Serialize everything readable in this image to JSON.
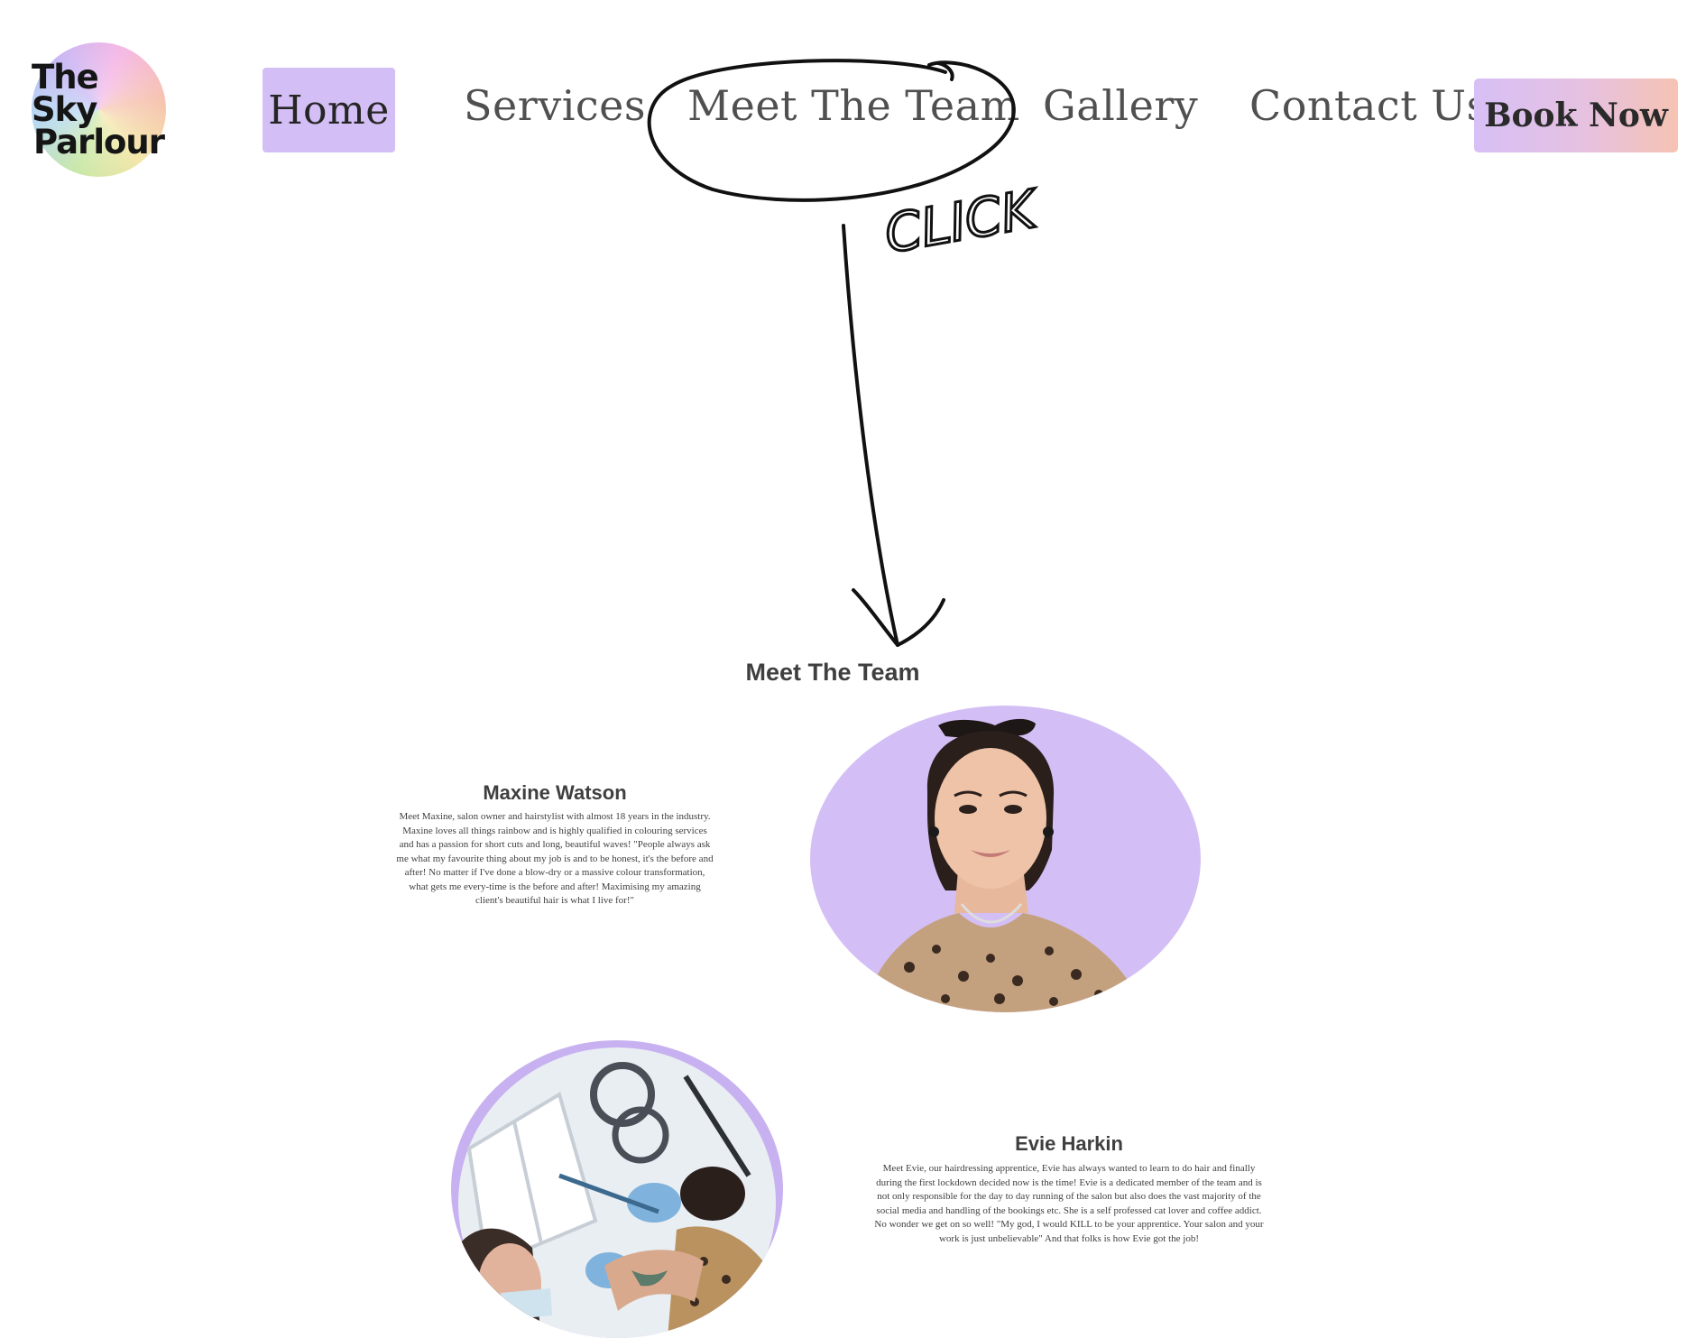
{
  "logo": {
    "line1": "The Sky",
    "line2": "Parlour"
  },
  "nav": {
    "home": "Home",
    "services": "Services",
    "meet_team": "Meet The Team",
    "gallery": "Gallery",
    "contact": "Contact Us",
    "book": "Book Now"
  },
  "annotation": {
    "text": "CLICK"
  },
  "team": {
    "title": "Meet The Team",
    "members": [
      {
        "name": "Maxine Watson",
        "bio": [
          "Meet Maxine, salon owner and hairstylist with almost 18 years in the industry.",
          "Maxine loves all things rainbow and is highly qualified in colouring services",
          "and has a passion for short cuts and long, beautiful waves! \"People always ask",
          "me what my favourite thing about my job is and to be honest, it's the before and",
          "after! No matter if I've done a blow-dry or a massive colour transformation,",
          "what gets me every-time is the before and after! Maximising my amazing",
          "client's beautiful hair is what I live for!\""
        ]
      },
      {
        "name": "Evie Harkin",
        "bio": [
          "Meet Evie, our hairdressing apprentice, Evie has always wanted to learn to do hair and finally",
          "during the first lockdown decided now is the time! Evie is a dedicated member of the team and is",
          "not only responsible for the day to day running of the salon but also does the vast majority of the",
          "social media and handling of the bookings etc. She is a self professed cat lover and coffee addict.",
          "No wonder we get on so well! \"My god, I would KILL to be your apprentice. Your salon and your",
          "work is just unbelievable\" And that folks is how Evie got the job!"
        ]
      }
    ]
  },
  "colors": {
    "lavender": "#d3bff5",
    "peach": "#f6c3b3",
    "text": "#3f3f3f"
  }
}
